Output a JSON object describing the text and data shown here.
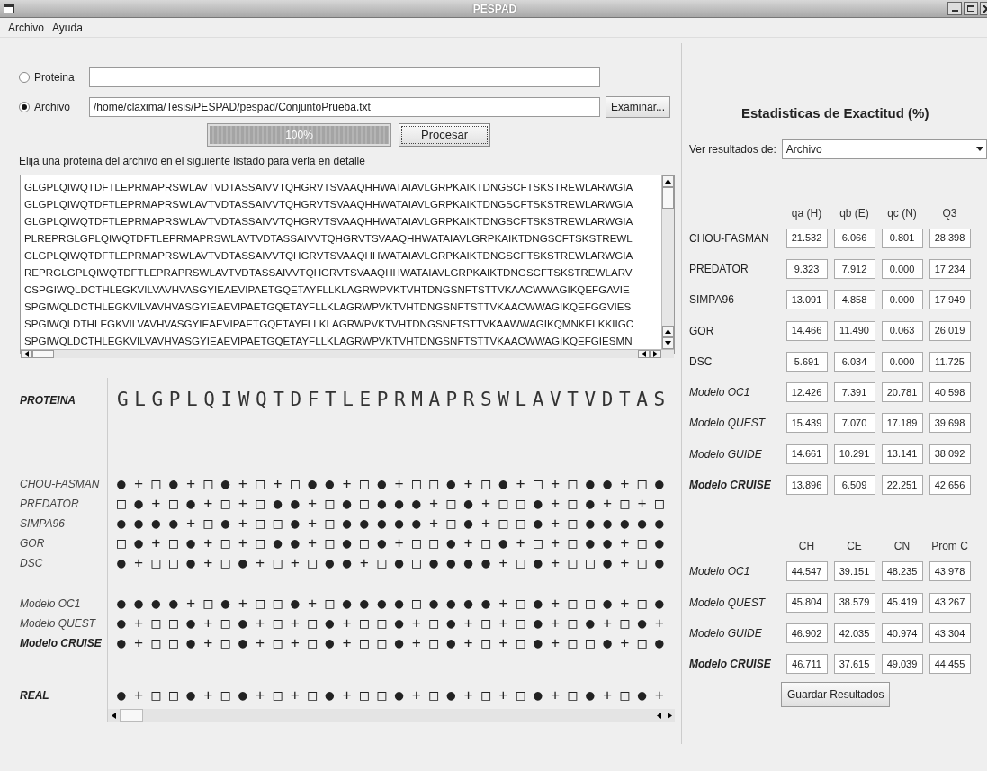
{
  "window": {
    "title": "PESPAD"
  },
  "menu": [
    "Archivo",
    "Ayuda"
  ],
  "input": {
    "options": [
      {
        "label": "Proteina",
        "selected": false
      },
      {
        "label": "Archivo",
        "selected": true,
        "value": "/home/claxima/Tesis/PESPAD/pespad/ConjuntoPrueba.txt"
      }
    ],
    "browse_button": "Examinar...",
    "progress": {
      "level": 1,
      "reading": "100%"
    },
    "process_button": "Procesar"
  },
  "list_caption": "Elija una proteina del archivo en el siguiente listado para verla en detalle",
  "protein_list": [
    "GLGPLQIWQTDFTLEPRMAPRSWLAVTVDTASSAIVVTQHGRVTSVAAQHHWATAIAVLGRPKAIKTDNGSCFTSKSTREWLARWGIA",
    "GLGPLQIWQTDFTLEPRMAPRSWLAVTVDTASSAIVVTQHGRVTSVAAQHHWATAIAVLGRPKAIKTDNGSCFTSKSTREWLARWGIA",
    "GLGPLQIWQTDFTLEPRMAPRSWLAVTVDTASSAIVVTQHGRVTSVAAQHHWATAIAVLGRPKAIKTDNGSCFTSKSTREWLARWGIA",
    "PLREPRGLGPLQIWQTDFTLEPRMAPRSWLAVTVDTASSAIVVTQHGRVTSVAAQHHWATAIAVLGRPKAIKTDNGSCFTSKSTREWL",
    "GLGPLQIWQTDFTLEPRMAPRSWLAVTVDTASSAIVVTQHGRVTSVAAQHHWATAIAVLGRPKAIKTDNGSCFTSKSTREWLARWGIA",
    "REPRGLGPLQIWQTDFTLEPRAPRSWLAVTVDTASSAIVVTQHGRVTSVAAQHHWATAIAVLGRPKAIKTDNGSCFTSKSTREWLARV",
    "CSPGIWQLDCTHLEGKVILVAVHVASGYIEAEVIPAETGQETAYFLLKLAGRWPVKTVHTDNGSNFTSTTVKAACWWAGIKQEFGAVIE",
    "SPGIWQLDCTHLEGKVILVAVHVASGYIEAEVIPAETGQETAYFLLKLAGRWPVKTVHTDNGSNFTSTTVKAACWWAGIKQEFGGVIES",
    "SPGIWQLDTHLEGKVILVAVHVASGYIEAEVIPAETGQETAYFLLKLAGRWPVKTVHTDNGSNFTSTTVKAAWWAGIKQMNKELKKIIGC",
    "SPGIWQLDCTHLEGKVILVAVHVASGYIEAEVIPAETGQETAYFLLKLAGRWPVKTVHTDNGSNFTSTTVKAACWWAGIKQEFGIESMN"
  ],
  "detail": {
    "rows": [
      {
        "kind": "sequence",
        "label": "PROTEINA",
        "bold": true,
        "symbols": "GLGPLQIWQTDFTLEPRMAPRSWLAVTVDTAS"
      },
      {
        "kind": "gap"
      },
      {
        "kind": "symbols",
        "label": "CHOU-FASMAN",
        "bold": false,
        "symbols": "●+□●+□●+□+□●●+□●+□□●+□●+□+□●●+□●"
      },
      {
        "kind": "symbols",
        "label": "PREDATOR",
        "bold": false,
        "symbols": "□●+□●+□+□●●+□●□●●●+□●+□□●+□●+□+□"
      },
      {
        "kind": "symbols",
        "label": "SIMPA96",
        "bold": false,
        "symbols": "●●●●+□●+□□●+□●●●●●+□●+□□●+□●●●●●"
      },
      {
        "kind": "symbols",
        "label": "GOR",
        "bold": false,
        "symbols": "□●+□●+□+□●●+□●□●+□□●+□●+□+□●●+□●"
      },
      {
        "kind": "symbols",
        "label": "DSC",
        "bold": false,
        "symbols": "●+□□●+□●+□+□●●+□●□●●●●+□●+□□●+□●"
      },
      {
        "kind": "gap"
      },
      {
        "kind": "symbols",
        "label": "Modelo OC1",
        "bold": false,
        "symbols": "●●●●+□●+□□●+□●●●●□●●●●+□●+□□●+□●"
      },
      {
        "kind": "symbols",
        "label": "Modelo QUEST",
        "bold": false,
        "symbols": "●+□□●+□●+□+□●+□□●+□●+□+□●+□●+□●+"
      },
      {
        "kind": "symbols",
        "label": "Modelo CRUISE",
        "bold": true,
        "symbols": "●+□□●+□●+□+□●+□□●+□●+□+□●+□□●+□●"
      },
      {
        "kind": "gap"
      },
      {
        "kind": "symbols",
        "label": "REAL",
        "bold": true,
        "symbols": "●+□□●+□●+□+□●+□□●+□●+□+□●+□●+□●+"
      }
    ]
  },
  "stats": {
    "title": "Estadisticas de Exactitud (%)",
    "view_label": "Ver resultados de:",
    "view_value": "Archivo",
    "tables": [
      {
        "columns": [
          "qa (H)",
          "qb (E)",
          "qc (N)",
          "Q3"
        ],
        "rows": [
          {
            "name": "CHOU-FASMAN",
            "kind": "method",
            "values": [
              "21.532",
              "6.066",
              "0.801",
              "28.398"
            ]
          },
          {
            "name": "PREDATOR",
            "kind": "method",
            "values": [
              "9.323",
              "7.912",
              "0.000",
              "17.234"
            ]
          },
          {
            "name": "SIMPA96",
            "kind": "method",
            "values": [
              "13.091",
              "4.858",
              "0.000",
              "17.949"
            ]
          },
          {
            "name": "GOR",
            "kind": "method",
            "values": [
              "14.466",
              "11.490",
              "0.063",
              "26.019"
            ]
          },
          {
            "name": "DSC",
            "kind": "method",
            "values": [
              "5.691",
              "6.034",
              "0.000",
              "11.725"
            ]
          },
          {
            "name": "Modelo OC1",
            "kind": "model",
            "values": [
              "12.426",
              "7.391",
              "20.781",
              "40.598"
            ]
          },
          {
            "name": "Modelo QUEST",
            "kind": "model",
            "values": [
              "15.439",
              "7.070",
              "17.189",
              "39.698"
            ]
          },
          {
            "name": "Modelo GUIDE",
            "kind": "model",
            "values": [
              "14.661",
              "10.291",
              "13.141",
              "38.092"
            ]
          },
          {
            "name": "Modelo CRUISE",
            "kind": "best",
            "values": [
              "13.896",
              "6.509",
              "22.251",
              "42.656"
            ]
          }
        ]
      },
      {
        "columns": [
          "CH",
          "CE",
          "CN",
          "Prom C"
        ],
        "rows": [
          {
            "name": "Modelo OC1",
            "kind": "model",
            "values": [
              "44.547",
              "39.151",
              "48.235",
              "43.978"
            ]
          },
          {
            "name": "Modelo QUEST",
            "kind": "model",
            "values": [
              "45.804",
              "38.579",
              "45.419",
              "43.267"
            ]
          },
          {
            "name": "Modelo GUIDE",
            "kind": "model",
            "values": [
              "46.902",
              "42.035",
              "40.974",
              "43.304"
            ]
          },
          {
            "name": "Modelo CRUISE",
            "kind": "best",
            "values": [
              "46.711",
              "37.615",
              "49.039",
              "44.455"
            ]
          }
        ]
      }
    ],
    "save_button": "Guardar Resultados"
  }
}
